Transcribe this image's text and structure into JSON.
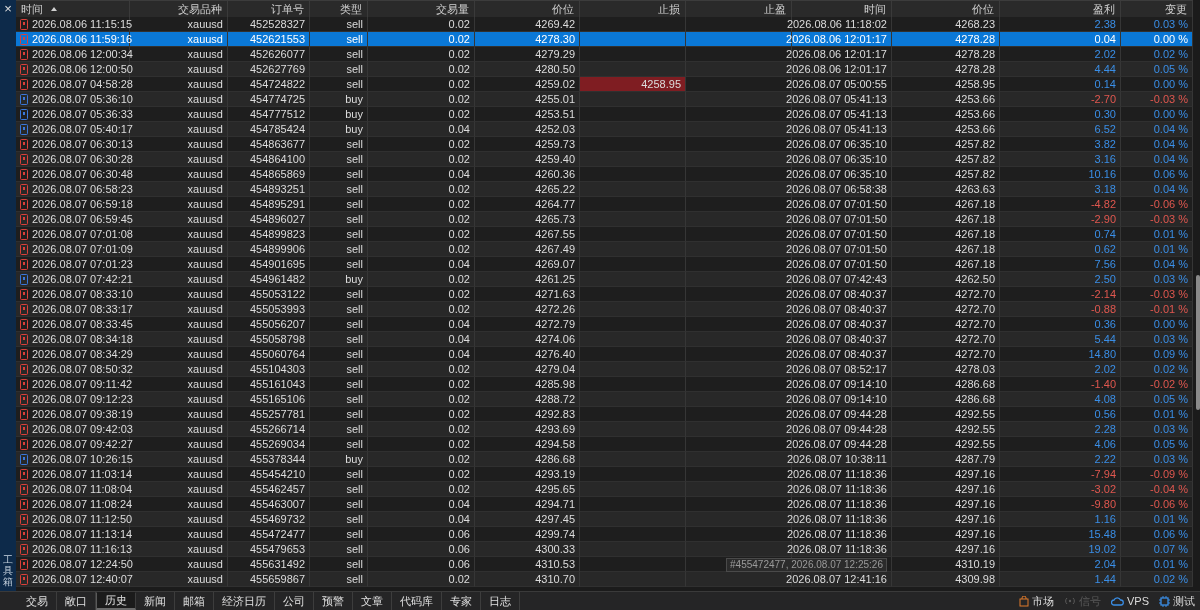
{
  "sidebar": {
    "close": "×",
    "title": "工具箱"
  },
  "columns": [
    {
      "label": "时间",
      "sorted": true
    },
    {
      "label": "交易品种",
      "sorted": false
    },
    {
      "label": "订单号",
      "sorted": false
    },
    {
      "label": "类型",
      "sorted": false
    },
    {
      "label": "交易量",
      "sorted": false
    },
    {
      "label": "价位",
      "sorted": false
    },
    {
      "label": "止损",
      "sorted": false
    },
    {
      "label": "止盈",
      "sorted": false
    },
    {
      "label": "时间",
      "sorted": false
    },
    {
      "label": "价位",
      "sorted": false
    },
    {
      "label": "盈利",
      "sorted": false
    },
    {
      "label": "变更",
      "sorted": false
    }
  ],
  "rows": [
    {
      "open_time": "2026.08.06 11:15:15",
      "symbol": "xauusd",
      "order": "452528327",
      "type": "sell",
      "kind": "sell",
      "volume": "0.02",
      "price": "4269.42",
      "sl_hit": false,
      "close_time": "2026.08.06 11:18:02",
      "close_price": "4268.23",
      "profit": "2.38",
      "change": "0.03 %",
      "loss": false,
      "selected": false
    },
    {
      "open_time": "2026.08.06 11:59:16",
      "symbol": "xauusd",
      "order": "452621553",
      "type": "sell",
      "kind": "sell",
      "volume": "0.02",
      "price": "4278.30",
      "sl_hit": false,
      "close_time": "2026.08.06 12:01:17",
      "close_price": "4278.28",
      "profit": "0.04",
      "change": "0.00 %",
      "selected": true
    },
    {
      "open_time": "2026.08.06 12:00:34",
      "symbol": "xauusd",
      "order": "452626077",
      "type": "sell",
      "kind": "sell",
      "volume": "0.02",
      "price": "4279.29",
      "sl_hit": false,
      "close_time": "2026.08.06 12:01:17",
      "close_price": "4278.28",
      "profit": "2.02",
      "change": "0.02 %",
      "loss": false,
      "selected": false
    },
    {
      "open_time": "2026.08.06 12:00:50",
      "symbol": "xauusd",
      "order": "452627769",
      "type": "sell",
      "kind": "sell",
      "volume": "0.02",
      "price": "4280.50",
      "sl_hit": false,
      "close_time": "2026.08.06 12:01:17",
      "close_price": "4278.28",
      "profit": "4.44",
      "change": "0.05 %",
      "loss": false,
      "selected": false
    },
    {
      "open_time": "2026.08.07 04:58:28",
      "symbol": "xauusd",
      "order": "454724822",
      "type": "sell",
      "kind": "sell",
      "volume": "0.02",
      "price": "4259.02",
      "stop_loss": "4258.95",
      "sl_hit": true,
      "close_time": "2026.08.07 05:00:55",
      "close_price": "4258.95",
      "profit": "0.14",
      "change": "0.00 %",
      "loss": false,
      "selected": false
    },
    {
      "open_time": "2026.08.07 05:36:10",
      "symbol": "xauusd",
      "order": "454774725",
      "type": "buy",
      "kind": "buy",
      "volume": "0.02",
      "price": "4255.01",
      "sl_hit": false,
      "close_time": "2026.08.07 05:41:13",
      "close_price": "4253.66",
      "profit": "-2.70",
      "change": "-0.03 %",
      "loss": true,
      "selected": false
    },
    {
      "open_time": "2026.08.07 05:36:33",
      "symbol": "xauusd",
      "order": "454777512",
      "type": "buy",
      "kind": "buy",
      "volume": "0.02",
      "price": "4253.51",
      "sl_hit": false,
      "close_time": "2026.08.07 05:41:13",
      "close_price": "4253.66",
      "profit": "0.30",
      "change": "0.00 %",
      "loss": false,
      "selected": false
    },
    {
      "open_time": "2026.08.07 05:40:17",
      "symbol": "xauusd",
      "order": "454785424",
      "type": "buy",
      "kind": "buy",
      "volume": "0.04",
      "price": "4252.03",
      "sl_hit": false,
      "close_time": "2026.08.07 05:41:13",
      "close_price": "4253.66",
      "profit": "6.52",
      "change": "0.04 %",
      "loss": false,
      "selected": false
    },
    {
      "open_time": "2026.08.07 06:30:13",
      "symbol": "xauusd",
      "order": "454863677",
      "type": "sell",
      "kind": "sell",
      "volume": "0.02",
      "price": "4259.73",
      "sl_hit": false,
      "close_time": "2026.08.07 06:35:10",
      "close_price": "4257.82",
      "profit": "3.82",
      "change": "0.04 %",
      "loss": false,
      "selected": false
    },
    {
      "open_time": "2026.08.07 06:30:28",
      "symbol": "xauusd",
      "order": "454864100",
      "type": "sell",
      "kind": "sell",
      "volume": "0.02",
      "price": "4259.40",
      "sl_hit": false,
      "close_time": "2026.08.07 06:35:10",
      "close_price": "4257.82",
      "profit": "3.16",
      "change": "0.04 %",
      "loss": false,
      "selected": false
    },
    {
      "open_time": "2026.08.07 06:30:48",
      "symbol": "xauusd",
      "order": "454865869",
      "type": "sell",
      "kind": "sell",
      "volume": "0.04",
      "price": "4260.36",
      "sl_hit": false,
      "close_time": "2026.08.07 06:35:10",
      "close_price": "4257.82",
      "profit": "10.16",
      "change": "0.06 %",
      "loss": false,
      "selected": false
    },
    {
      "open_time": "2026.08.07 06:58:23",
      "symbol": "xauusd",
      "order": "454893251",
      "type": "sell",
      "kind": "sell",
      "volume": "0.02",
      "price": "4265.22",
      "sl_hit": false,
      "close_time": "2026.08.07 06:58:38",
      "close_price": "4263.63",
      "profit": "3.18",
      "change": "0.04 %",
      "loss": false,
      "selected": false
    },
    {
      "open_time": "2026.08.07 06:59:18",
      "symbol": "xauusd",
      "order": "454895291",
      "type": "sell",
      "kind": "sell",
      "volume": "0.02",
      "price": "4264.77",
      "sl_hit": false,
      "close_time": "2026.08.07 07:01:50",
      "close_price": "4267.18",
      "profit": "-4.82",
      "change": "-0.06 %",
      "loss": true,
      "selected": false
    },
    {
      "open_time": "2026.08.07 06:59:45",
      "symbol": "xauusd",
      "order": "454896027",
      "type": "sell",
      "kind": "sell",
      "volume": "0.02",
      "price": "4265.73",
      "sl_hit": false,
      "close_time": "2026.08.07 07:01:50",
      "close_price": "4267.18",
      "profit": "-2.90",
      "change": "-0.03 %",
      "loss": true,
      "selected": false
    },
    {
      "open_time": "2026.08.07 07:01:08",
      "symbol": "xauusd",
      "order": "454899823",
      "type": "sell",
      "kind": "sell",
      "volume": "0.02",
      "price": "4267.55",
      "sl_hit": false,
      "close_time": "2026.08.07 07:01:50",
      "close_price": "4267.18",
      "profit": "0.74",
      "change": "0.01 %",
      "loss": false,
      "selected": false
    },
    {
      "open_time": "2026.08.07 07:01:09",
      "symbol": "xauusd",
      "order": "454899906",
      "type": "sell",
      "kind": "sell",
      "volume": "0.02",
      "price": "4267.49",
      "sl_hit": false,
      "close_time": "2026.08.07 07:01:50",
      "close_price": "4267.18",
      "profit": "0.62",
      "change": "0.01 %",
      "loss": false,
      "selected": false
    },
    {
      "open_time": "2026.08.07 07:01:23",
      "symbol": "xauusd",
      "order": "454901695",
      "type": "sell",
      "kind": "sell",
      "volume": "0.04",
      "price": "4269.07",
      "sl_hit": false,
      "close_time": "2026.08.07 07:01:50",
      "close_price": "4267.18",
      "profit": "7.56",
      "change": "0.04 %",
      "loss": false,
      "selected": false
    },
    {
      "open_time": "2026.08.07 07:42:21",
      "symbol": "xauusd",
      "order": "454961482",
      "type": "buy",
      "kind": "buy",
      "volume": "0.02",
      "price": "4261.25",
      "sl_hit": false,
      "close_time": "2026.08.07 07:42:43",
      "close_price": "4262.50",
      "profit": "2.50",
      "change": "0.03 %",
      "loss": false,
      "selected": false
    },
    {
      "open_time": "2026.08.07 08:33:10",
      "symbol": "xauusd",
      "order": "455053122",
      "type": "sell",
      "kind": "sell",
      "volume": "0.02",
      "price": "4271.63",
      "sl_hit": false,
      "close_time": "2026.08.07 08:40:37",
      "close_price": "4272.70",
      "profit": "-2.14",
      "change": "-0.03 %",
      "loss": true,
      "selected": false
    },
    {
      "open_time": "2026.08.07 08:33:17",
      "symbol": "xauusd",
      "order": "455053993",
      "type": "sell",
      "kind": "sell",
      "volume": "0.02",
      "price": "4272.26",
      "sl_hit": false,
      "close_time": "2026.08.07 08:40:37",
      "close_price": "4272.70",
      "profit": "-0.88",
      "change": "-0.01 %",
      "loss": true,
      "selected": false
    },
    {
      "open_time": "2026.08.07 08:33:45",
      "symbol": "xauusd",
      "order": "455056207",
      "type": "sell",
      "kind": "sell",
      "volume": "0.04",
      "price": "4272.79",
      "sl_hit": false,
      "close_time": "2026.08.07 08:40:37",
      "close_price": "4272.70",
      "profit": "0.36",
      "change": "0.00 %",
      "loss": false,
      "selected": false
    },
    {
      "open_time": "2026.08.07 08:34:18",
      "symbol": "xauusd",
      "order": "455058798",
      "type": "sell",
      "kind": "sell",
      "volume": "0.04",
      "price": "4274.06",
      "sl_hit": false,
      "close_time": "2026.08.07 08:40:37",
      "close_price": "4272.70",
      "profit": "5.44",
      "change": "0.03 %",
      "loss": false,
      "selected": false
    },
    {
      "open_time": "2026.08.07 08:34:29",
      "symbol": "xauusd",
      "order": "455060764",
      "type": "sell",
      "kind": "sell",
      "volume": "0.04",
      "price": "4276.40",
      "sl_hit": false,
      "close_time": "2026.08.07 08:40:37",
      "close_price": "4272.70",
      "profit": "14.80",
      "change": "0.09 %",
      "loss": false,
      "selected": false
    },
    {
      "open_time": "2026.08.07 08:50:32",
      "symbol": "xauusd",
      "order": "455104303",
      "type": "sell",
      "kind": "sell",
      "volume": "0.02",
      "price": "4279.04",
      "sl_hit": false,
      "close_time": "2026.08.07 08:52:17",
      "close_price": "4278.03",
      "profit": "2.02",
      "change": "0.02 %",
      "loss": false,
      "selected": false
    },
    {
      "open_time": "2026.08.07 09:11:42",
      "symbol": "xauusd",
      "order": "455161043",
      "type": "sell",
      "kind": "sell",
      "volume": "0.02",
      "price": "4285.98",
      "sl_hit": false,
      "close_time": "2026.08.07 09:14:10",
      "close_price": "4286.68",
      "profit": "-1.40",
      "change": "-0.02 %",
      "loss": true,
      "selected": false
    },
    {
      "open_time": "2026.08.07 09:12:23",
      "symbol": "xauusd",
      "order": "455165106",
      "type": "sell",
      "kind": "sell",
      "volume": "0.02",
      "price": "4288.72",
      "sl_hit": false,
      "close_time": "2026.08.07 09:14:10",
      "close_price": "4286.68",
      "profit": "4.08",
      "change": "0.05 %",
      "loss": false,
      "selected": false
    },
    {
      "open_time": "2026.08.07 09:38:19",
      "symbol": "xauusd",
      "order": "455257781",
      "type": "sell",
      "kind": "sell",
      "volume": "0.02",
      "price": "4292.83",
      "sl_hit": false,
      "close_time": "2026.08.07 09:44:28",
      "close_price": "4292.55",
      "profit": "0.56",
      "change": "0.01 %",
      "loss": false,
      "selected": false
    },
    {
      "open_time": "2026.08.07 09:42:03",
      "symbol": "xauusd",
      "order": "455266714",
      "type": "sell",
      "kind": "sell",
      "volume": "0.02",
      "price": "4293.69",
      "sl_hit": false,
      "close_time": "2026.08.07 09:44:28",
      "close_price": "4292.55",
      "profit": "2.28",
      "change": "0.03 %",
      "loss": false,
      "selected": false
    },
    {
      "open_time": "2026.08.07 09:42:27",
      "symbol": "xauusd",
      "order": "455269034",
      "type": "sell",
      "kind": "sell",
      "volume": "0.02",
      "price": "4294.58",
      "sl_hit": false,
      "close_time": "2026.08.07 09:44:28",
      "close_price": "4292.55",
      "profit": "4.06",
      "change": "0.05 %",
      "loss": false,
      "selected": false
    },
    {
      "open_time": "2026.08.07 10:26:15",
      "symbol": "xauusd",
      "order": "455378344",
      "type": "buy",
      "kind": "buy",
      "volume": "0.02",
      "price": "4286.68",
      "sl_hit": false,
      "close_time": "2026.08.07 10:38:11",
      "close_price": "4287.79",
      "profit": "2.22",
      "change": "0.03 %",
      "loss": false,
      "selected": false
    },
    {
      "open_time": "2026.08.07 11:03:14",
      "symbol": "xauusd",
      "order": "455454210",
      "type": "sell",
      "kind": "sell",
      "volume": "0.02",
      "price": "4293.19",
      "sl_hit": false,
      "close_time": "2026.08.07 11:18:36",
      "close_price": "4297.16",
      "profit": "-7.94",
      "change": "-0.09 %",
      "loss": true,
      "selected": false
    },
    {
      "open_time": "2026.08.07 11:08:04",
      "symbol": "xauusd",
      "order": "455462457",
      "type": "sell",
      "kind": "sell",
      "volume": "0.02",
      "price": "4295.65",
      "sl_hit": false,
      "close_time": "2026.08.07 11:18:36",
      "close_price": "4297.16",
      "profit": "-3.02",
      "change": "-0.04 %",
      "loss": true,
      "selected": false
    },
    {
      "open_time": "2026.08.07 11:08:24",
      "symbol": "xauusd",
      "order": "455463007",
      "type": "sell",
      "kind": "sell",
      "volume": "0.04",
      "price": "4294.71",
      "sl_hit": false,
      "close_time": "2026.08.07 11:18:36",
      "close_price": "4297.16",
      "profit": "-9.80",
      "change": "-0.06 %",
      "loss": true,
      "selected": false
    },
    {
      "open_time": "2026.08.07 11:12:50",
      "symbol": "xauusd",
      "order": "455469732",
      "type": "sell",
      "kind": "sell",
      "volume": "0.04",
      "price": "4297.45",
      "sl_hit": false,
      "close_time": "2026.08.07 11:18:36",
      "close_price": "4297.16",
      "profit": "1.16",
      "change": "0.01 %",
      "loss": false,
      "selected": false
    },
    {
      "open_time": "2026.08.07 11:13:14",
      "symbol": "xauusd",
      "order": "455472477",
      "type": "sell",
      "kind": "sell",
      "volume": "0.06",
      "price": "4299.74",
      "sl_hit": false,
      "close_time": "2026.08.07 11:18:36",
      "close_price": "4297.16",
      "profit": "15.48",
      "change": "0.06 %",
      "loss": false,
      "selected": false
    },
    {
      "open_time": "2026.08.07 11:16:13",
      "symbol": "xauusd",
      "order": "455479653",
      "type": "sell",
      "kind": "sell",
      "volume": "0.06",
      "price": "4300.33",
      "sl_hit": false,
      "close_time": "2026.08.07 11:18:36",
      "close_price": "4297.16",
      "profit": "19.02",
      "change": "0.07 %",
      "loss": false,
      "selected": false
    },
    {
      "open_time": "2026.08.07 12:24:50",
      "symbol": "xauusd",
      "order": "455631492",
      "type": "sell",
      "kind": "sell",
      "volume": "0.06",
      "price": "4310.53",
      "sl_hit": false,
      "tooltip": "#455472477, 2026.08.07 12:25:26",
      "close_price": "4310.19",
      "profit": "2.04",
      "change": "0.01 %",
      "loss": false,
      "selected": false
    },
    {
      "open_time": "2026.08.07 12:40:07",
      "symbol": "xauusd",
      "order": "455659867",
      "type": "sell",
      "kind": "sell",
      "volume": "0.02",
      "price": "4310.70",
      "sl_hit": false,
      "close_time": "2026.08.07 12:41:16",
      "close_price": "4309.98",
      "profit": "1.44",
      "change": "0.02 %",
      "loss": false,
      "selected": false
    }
  ],
  "tabs": [
    {
      "label": "交易",
      "selected": false
    },
    {
      "label": "敞口",
      "selected": false
    },
    {
      "label": "历史",
      "selected": true
    },
    {
      "label": "新闻",
      "selected": false
    },
    {
      "label": "邮箱",
      "selected": false
    },
    {
      "label": "经济日历",
      "selected": false
    },
    {
      "label": "公司",
      "selected": false
    },
    {
      "label": "预警",
      "selected": false
    },
    {
      "label": "文章",
      "selected": false
    },
    {
      "label": "代码库",
      "selected": false
    },
    {
      "label": "专家",
      "selected": false
    },
    {
      "label": "日志",
      "selected": false
    }
  ],
  "status_items": [
    {
      "label": "市场",
      "kind": "market",
      "disabled": false
    },
    {
      "label": "信号",
      "kind": "signal",
      "disabled": true
    },
    {
      "label": "VPS",
      "kind": "vps",
      "disabled": false
    },
    {
      "label": "测试",
      "kind": "test",
      "disabled": false
    }
  ]
}
